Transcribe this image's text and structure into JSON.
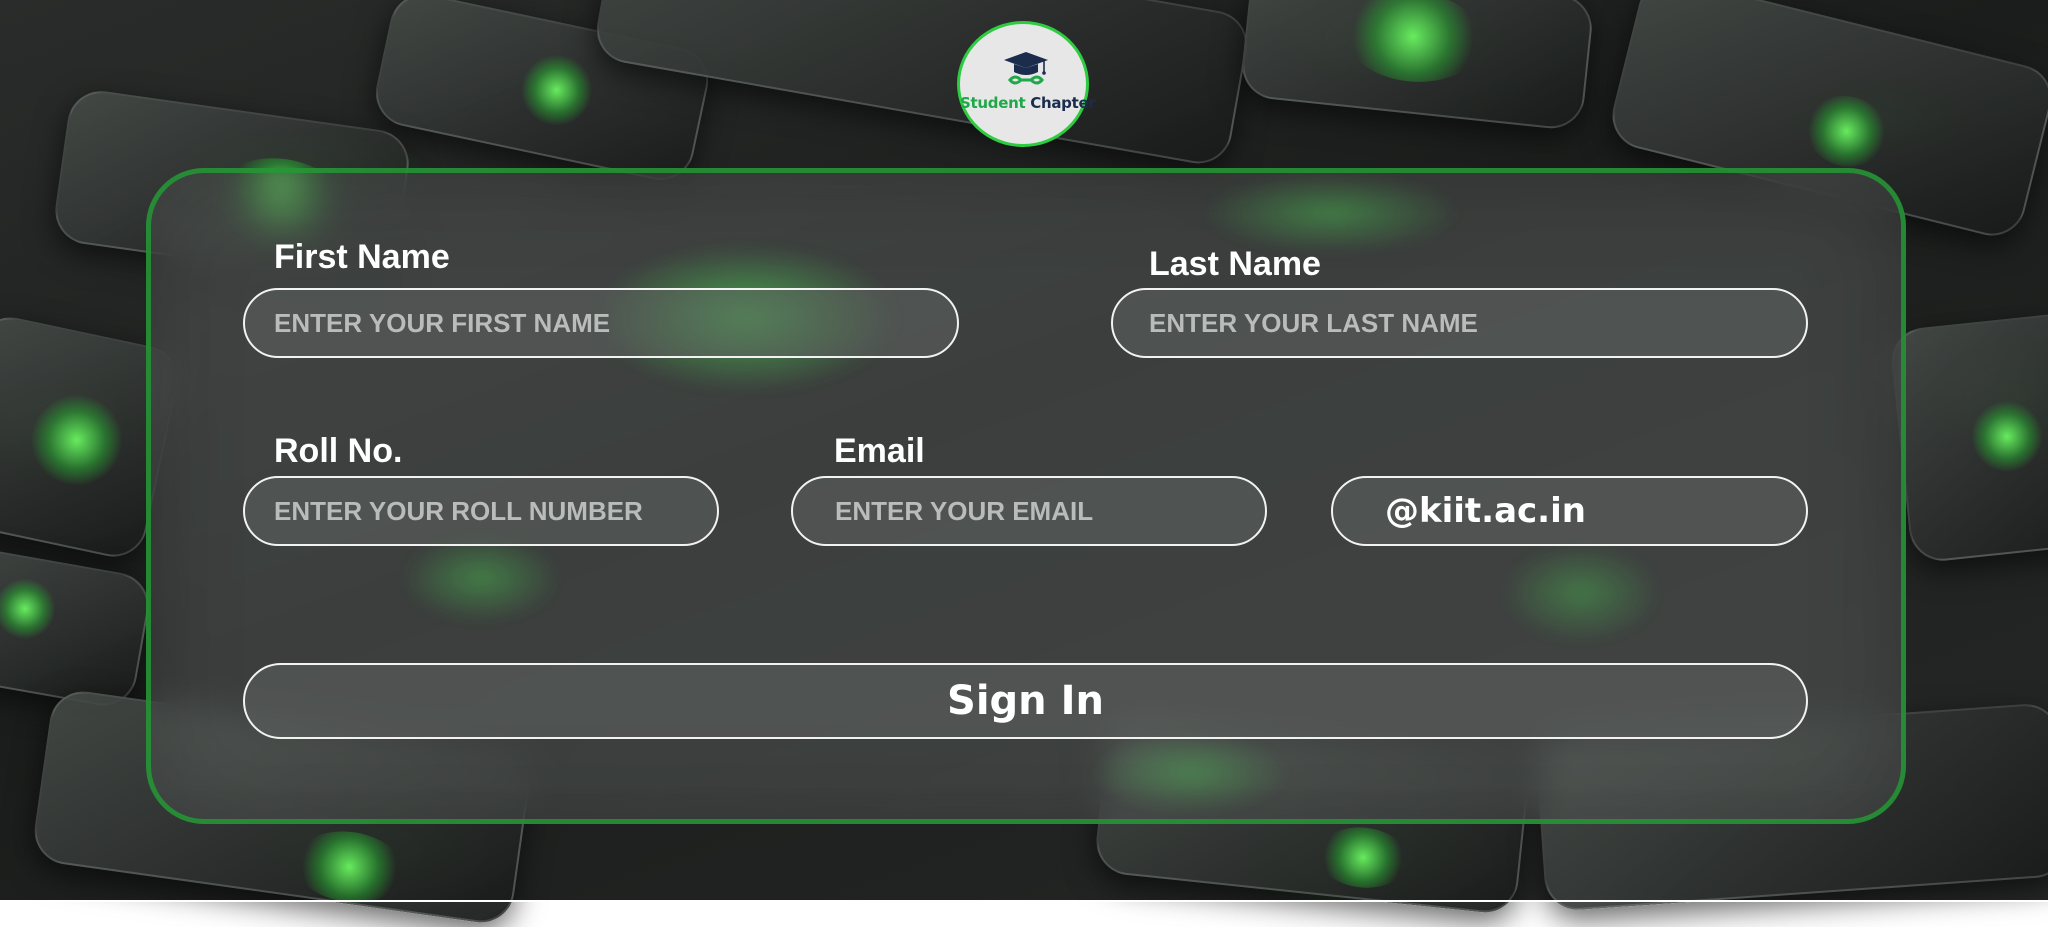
{
  "brand": {
    "logo_word_1": "Student",
    "logo_word_2": "Chapter",
    "logo_icon": "graduation-cap-icon",
    "accent_green": "#2ecc40",
    "logo_navy": "#1b2c4c"
  },
  "form": {
    "first_name": {
      "label": "First Name",
      "placeholder": "ENTER YOUR FIRST NAME",
      "value": ""
    },
    "last_name": {
      "label": "Last Name",
      "placeholder": "ENTER YOUR LAST NAME",
      "value": ""
    },
    "roll_no": {
      "label": "Roll No.",
      "placeholder": "ENTER YOUR ROLL NUMBER",
      "value": ""
    },
    "email": {
      "label": "Email",
      "placeholder": "ENTER YOUR EMAIL",
      "value": "",
      "domain_suffix": "@kiit.ac.in"
    },
    "submit_label": "Sign In"
  }
}
